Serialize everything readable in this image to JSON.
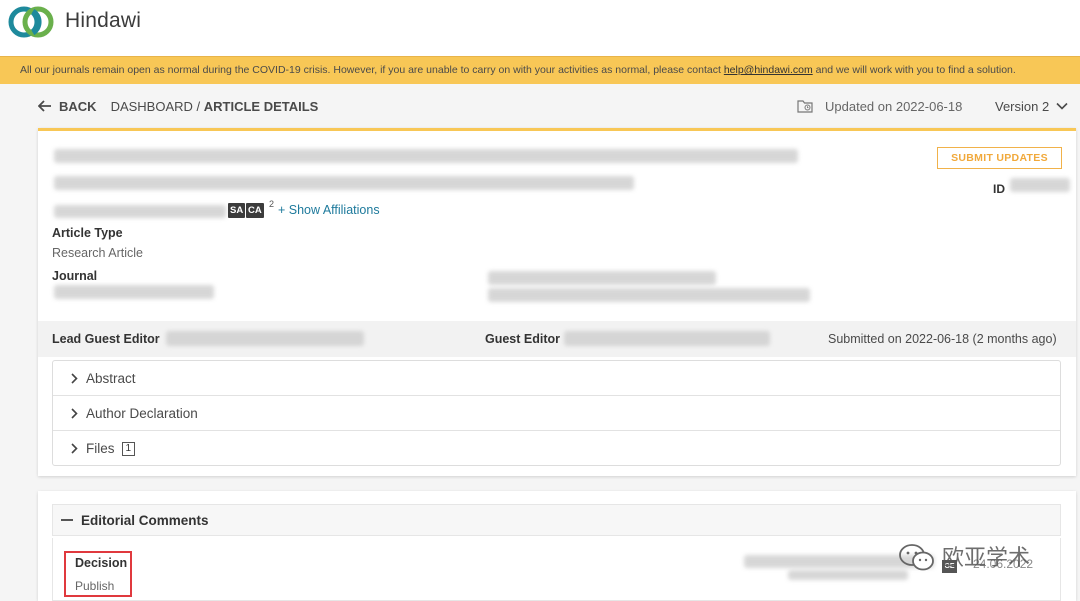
{
  "brand": {
    "name": "Hindawi",
    "colors": {
      "teal": "#1e8a9c",
      "green": "#6ab04c",
      "accent": "#f8c756"
    }
  },
  "banner": {
    "text_before": "All our journals remain open as normal during the COVID-19 crisis. However, if you are unable to carry on with your activities as normal, please contact ",
    "email": "help@hindawi.com",
    "text_after": " and we will work with you to find a solution."
  },
  "breadcrumb": {
    "back": "BACK",
    "dashboard": "DASHBOARD /",
    "current": "ARTICLE DETAILS"
  },
  "header_meta": {
    "updated": "Updated on 2022-06-18",
    "version": "Version 2"
  },
  "article": {
    "submit_label": "SUBMIT UPDATES",
    "id_label": "ID",
    "badges": [
      "SA",
      "CA"
    ],
    "affiliation_sup": "2",
    "show_affiliations": "+ Show Affiliations",
    "article_type_label": "Article Type",
    "article_type_value": "Research Article",
    "journal_label": "Journal"
  },
  "editors": {
    "lead_label": "Lead Guest Editor",
    "guest_label": "Guest Editor",
    "submitted": "Submitted on 2022-06-18 (2 months ago)"
  },
  "sections": [
    {
      "label": "Abstract"
    },
    {
      "label": "Author Declaration"
    },
    {
      "label": "Files",
      "count": "1"
    }
  ],
  "editorial": {
    "title": "Editorial Comments",
    "decision_label": "Decision",
    "decision_value": "Publish",
    "editor_badge": "GE",
    "date": "24.06.2022"
  },
  "watermark": {
    "text": "欧亚学术"
  }
}
